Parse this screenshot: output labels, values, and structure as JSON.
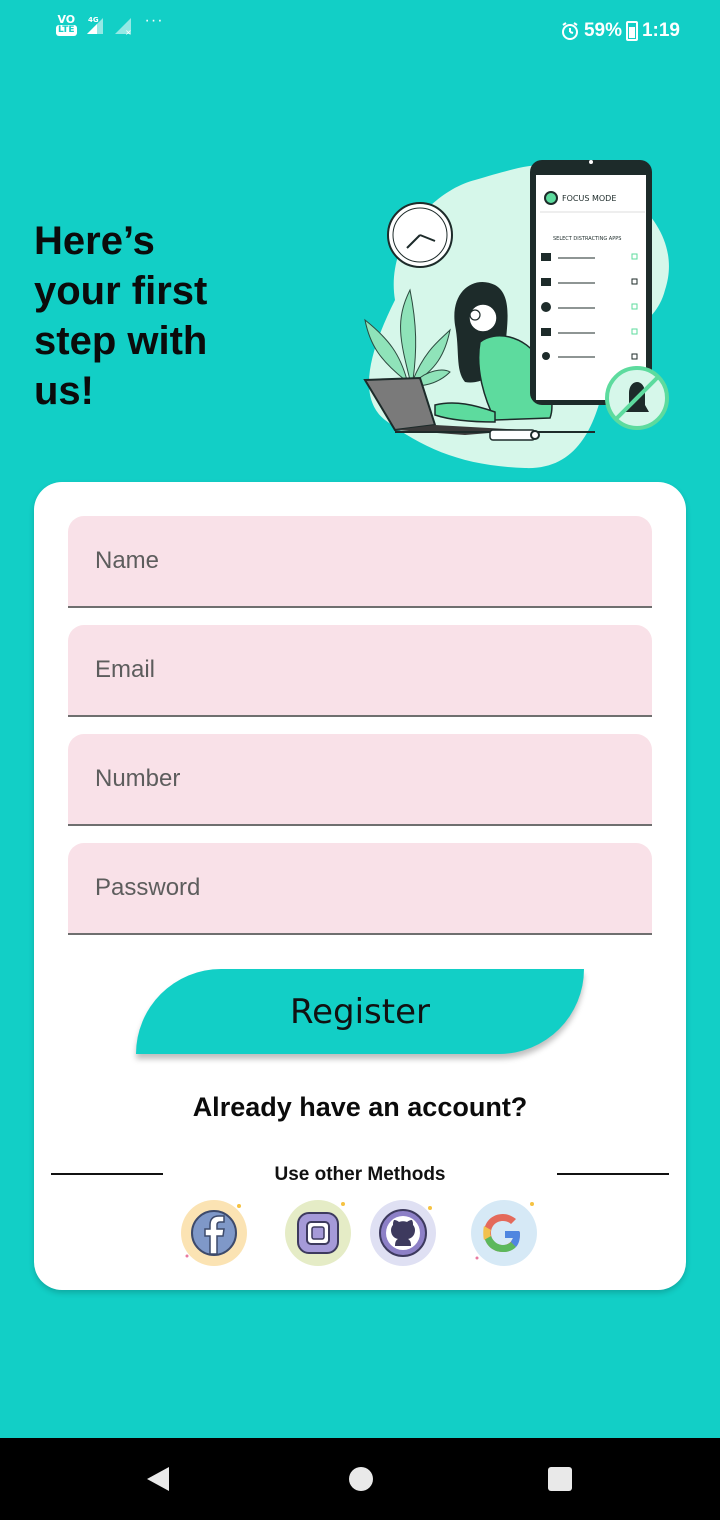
{
  "status_bar": {
    "volte": "VO",
    "lte": "LTE",
    "network": "4G",
    "overflow": "···",
    "battery": "59%",
    "time": "1:19"
  },
  "header": {
    "headline": "Here’s\nyour first\nstep with\nus!"
  },
  "illustration": {
    "phone_title": "FOCUS MODE",
    "phone_subtitle": "SELECT DISTRACTING APPS"
  },
  "form": {
    "name_placeholder": "Name",
    "email_placeholder": "Email",
    "number_placeholder": "Number",
    "password_placeholder": "Password",
    "register_label": "Register",
    "have_account": "Already have an account?",
    "other_methods": "Use other Methods"
  },
  "colors": {
    "background": "#12cfc6",
    "field_fill": "#f9e1e8",
    "accent_green": "#5ddb9e"
  },
  "social_icons": [
    "facebook-icon",
    "instagram-icon",
    "github-icon",
    "google-icon"
  ],
  "nav_icons": [
    "back-icon",
    "home-icon",
    "recents-icon"
  ]
}
